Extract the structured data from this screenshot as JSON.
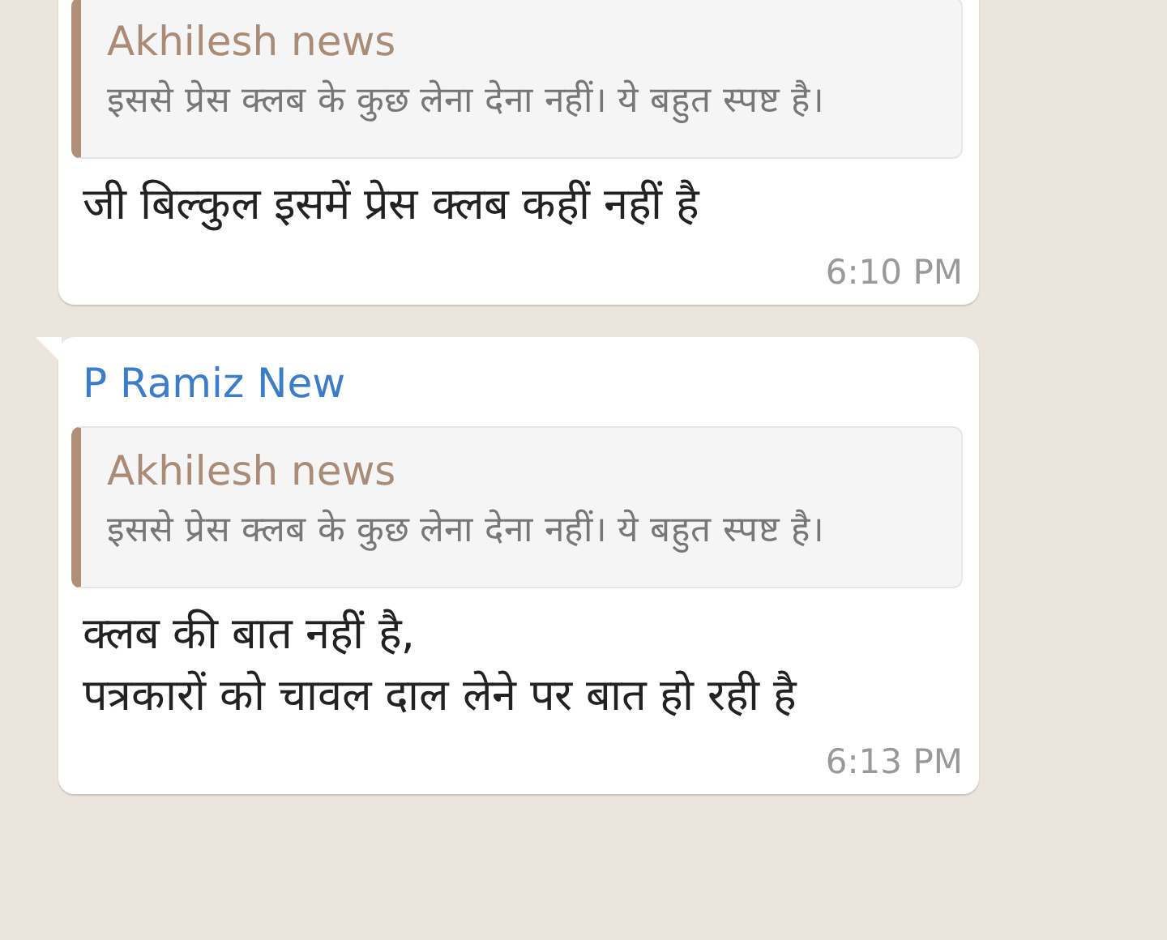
{
  "messages": [
    {
      "quote": {
        "author": "Akhilesh news",
        "text": "इससे प्रेस क्लब के कुछ लेना देना नहीं। ये बहुत स्पष्ट है।"
      },
      "lines": [
        "जी बिल्कुल इसमें प्रेस क्लब कहीं नहीं है"
      ],
      "time": "6:10 PM",
      "tail": false
    },
    {
      "sender": "P Ramiz New",
      "quote": {
        "author": "Akhilesh news",
        "text": "इससे प्रेस क्लब के कुछ लेना देना नहीं। ये बहुत स्पष्ट है।"
      },
      "lines": [
        "क्लब की बात नहीं है,",
        "पत्रकारों को चावल दाल लेने पर बात हो रही है"
      ],
      "time": "6:13 PM",
      "tail": true
    }
  ]
}
